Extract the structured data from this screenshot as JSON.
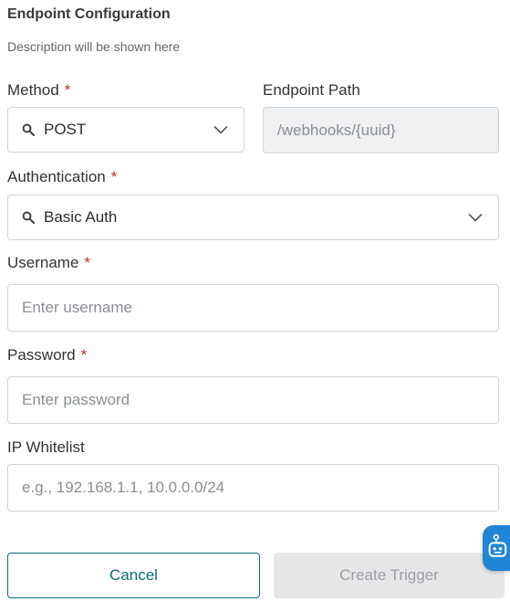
{
  "section": {
    "title": "Endpoint Configuration",
    "description": "Description will be shown here"
  },
  "required_marker": "*",
  "method": {
    "label": "Method",
    "value": "POST"
  },
  "endpoint_path": {
    "label": "Endpoint Path",
    "value": "/webhooks/{uuid}"
  },
  "authentication": {
    "label": "Authentication",
    "value": "Basic Auth"
  },
  "username": {
    "label": "Username",
    "placeholder": "Enter username"
  },
  "password": {
    "label": "Password",
    "placeholder": "Enter password"
  },
  "ip_whitelist": {
    "label": "IP Whitelist",
    "placeholder": "e.g., 192.168.1.1, 10.0.0.0/24"
  },
  "actions": {
    "cancel": "Cancel",
    "create": "Create Trigger"
  },
  "icons": {
    "search": "search-icon",
    "chevron": "chevron-down-icon",
    "assistant": "robot-icon"
  },
  "colors": {
    "required": "#c62828",
    "primary": "#0c6a79",
    "disabled_button_bg": "#e5e6e8",
    "disabled_field_bg": "#eef0f2",
    "assistant": "#1f86d6"
  }
}
